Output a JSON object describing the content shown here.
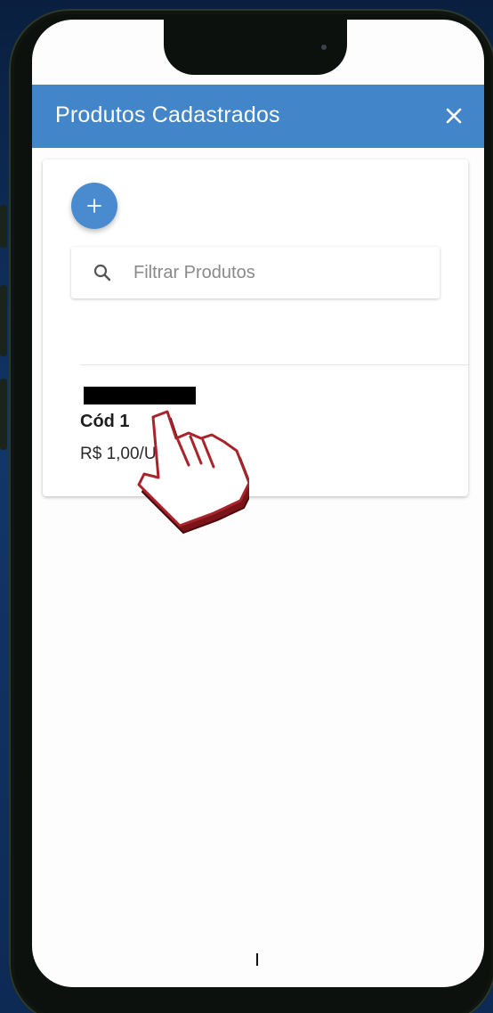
{
  "app_bar": {
    "title": "Produtos Cadastrados",
    "close_icon": "close-icon",
    "color": "#4285c9"
  },
  "toolbar": {
    "add_icon": "plus-icon"
  },
  "search": {
    "placeholder": "Filtrar Produtos",
    "value": "",
    "icon": "search-icon"
  },
  "products": [
    {
      "name": "",
      "code": "Cód 1",
      "price": "R$ 1,00/U"
    }
  ],
  "colors": {
    "accent": "#4285c9",
    "fab": "#4a8bd0",
    "cursor": "#a8242a"
  }
}
